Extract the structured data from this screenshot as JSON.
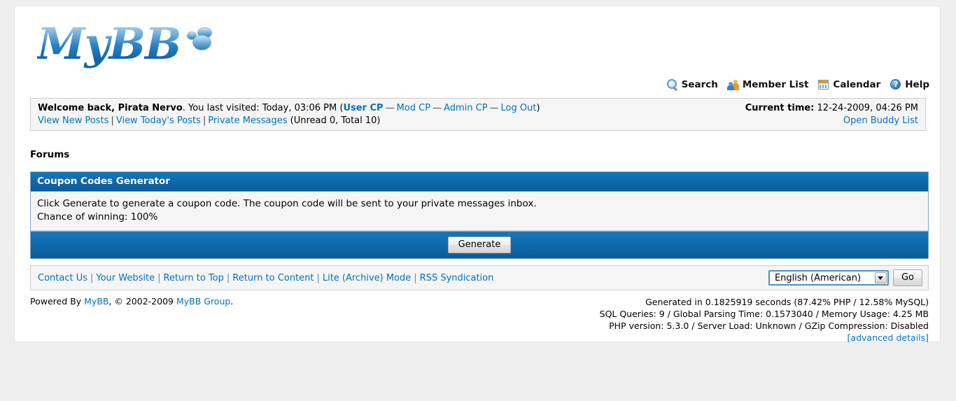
{
  "site": {
    "logo_text": "MyBB",
    "logo_icon": "speech-bubbles-icon"
  },
  "topnav": {
    "items": [
      {
        "label": "Search",
        "icon": "search-icon"
      },
      {
        "label": "Member List",
        "icon": "members-icon"
      },
      {
        "label": "Calendar",
        "icon": "calendar-icon"
      },
      {
        "label": "Help",
        "icon": "help-icon"
      }
    ]
  },
  "welcome": {
    "greeting_prefix": "Welcome back, ",
    "username": "Pirata Nervo",
    "last_visited": ". You last visited: Today, 03:06 PM (",
    "cp_links": [
      {
        "label": "User CP",
        "bold": true
      },
      {
        "label": "Mod CP",
        "bold": false
      },
      {
        "label": "Admin CP",
        "bold": false
      },
      {
        "label": "Log Out",
        "bold": false
      }
    ],
    "cp_separator": "—",
    "close_paren": ")",
    "quick_links": [
      "View New Posts",
      "View Today's Posts",
      "Private Messages"
    ],
    "pm_counts": "(Unread 0, Total 10)",
    "current_time_label": "Current time:",
    "current_time_value": "12-24-2009, 04:26 PM",
    "buddy_list_link": "Open Buddy List"
  },
  "breadcrumb": {
    "text": "Forums"
  },
  "panel": {
    "title": "Coupon Codes Generator",
    "body_line1": "Click Generate to generate a coupon code. The coupon code will be sent to your private messages inbox.",
    "body_line2": "Chance of winning: 100%",
    "generate_button": "Generate"
  },
  "bottom_bar": {
    "links": [
      "Contact Us",
      "Your Website",
      "Return to Top",
      "Return to Content",
      "Lite (Archive) Mode",
      "RSS Syndication"
    ],
    "separator": "|",
    "language_selected": "English (American)",
    "go_button": "Go"
  },
  "footer": {
    "powered_by_prefix": "Powered By ",
    "powered_by_link": "MyBB",
    "copyright": ", © 2002-2009 ",
    "group_link": "MyBB Group",
    "period": ".",
    "stats_line1": "Generated in 0.1825919 seconds (87.42% PHP / 12.58% MySQL)",
    "stats_line2": "SQL Queries: 9 / Global Parsing Time: 0.1573040 / Memory Usage: 4.25 MB",
    "stats_line3": "PHP version: 5.3.0 / Server Load: Unknown / GZip Compression: Disabled",
    "advanced_details": "[advanced details]"
  },
  "colors": {
    "accent_blue": "#0072BC",
    "header_blue": "#0E6BAE",
    "page_bg": "#EFEFEF",
    "panel_bg": "#F5F5F5"
  }
}
